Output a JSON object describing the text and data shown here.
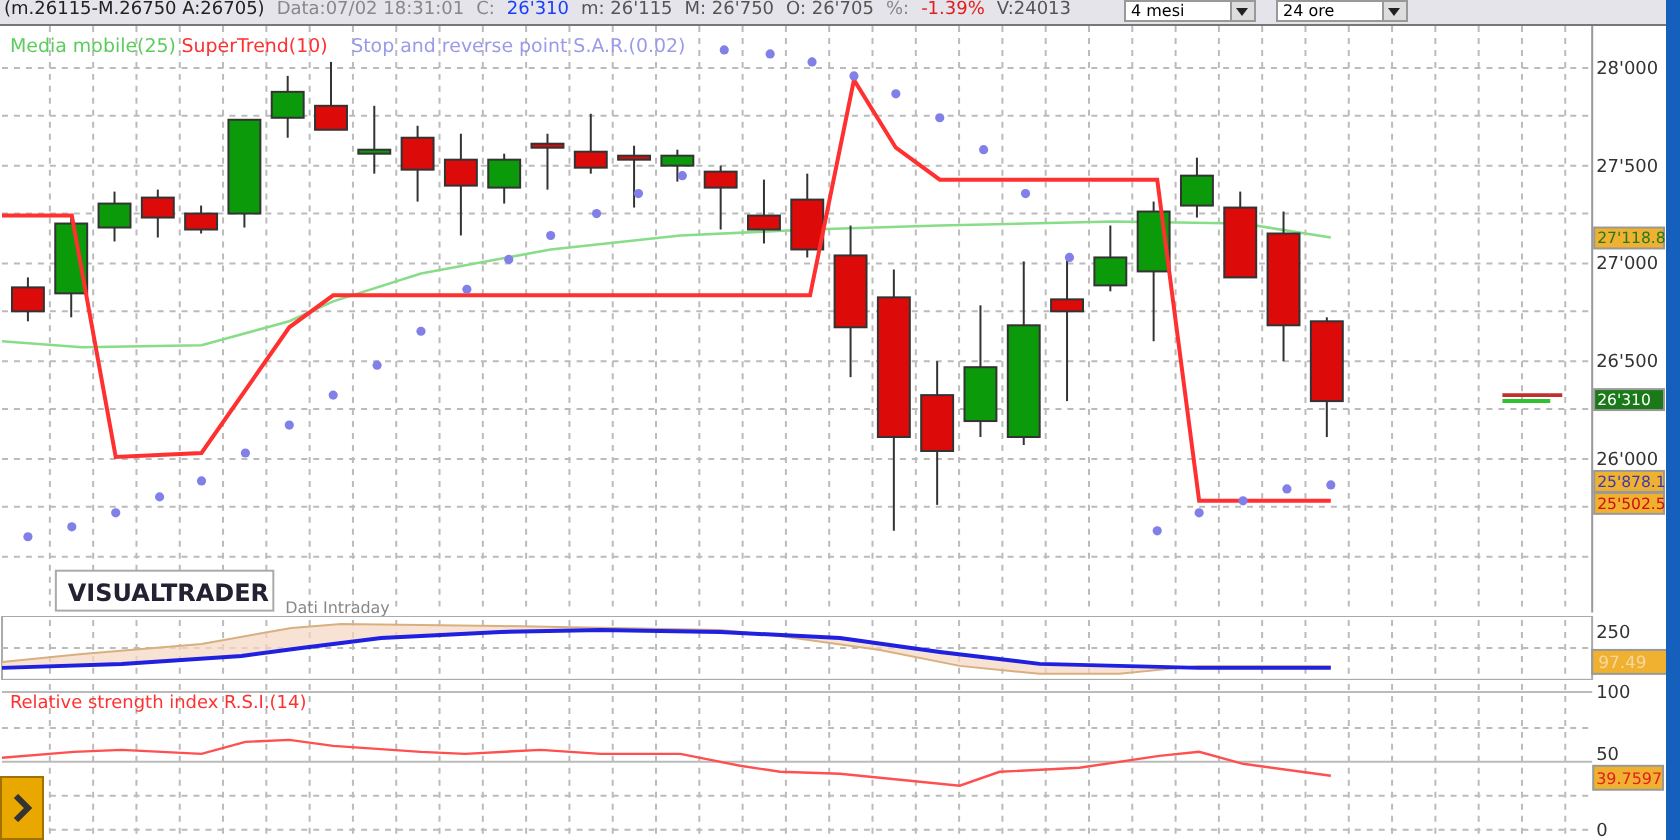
{
  "header": {
    "range": "(m.26115-M.26750 A:26705)",
    "date_label": "Data:",
    "date": "07/02 18:31:01",
    "close_label": "C:",
    "close": "26'310",
    "min_label": "m:",
    "min": "26'115",
    "max_label": "M:",
    "max": "26'750",
    "open_label": "O:",
    "open": "26'705",
    "pct_label": "%:",
    "pct": "-1.39%",
    "vol_label": "V:",
    "vol": "24013"
  },
  "dropdowns": [
    {
      "value": "4 mesi"
    },
    {
      "value": "24 ore"
    }
  ],
  "legend": [
    {
      "label": "Media mobile(25)",
      "color": "#5ccc5c"
    },
    {
      "label": "SuperTrend(10)",
      "color": "#ff3030"
    },
    {
      "label": "Stop and reverse point S.A.R.(0.02)",
      "color": "#9a9ae8"
    }
  ],
  "price_axis": [
    "28'000",
    "27'500",
    "27'000",
    "26'500",
    "26'000"
  ],
  "badges": [
    {
      "text": "27'118.8"
    },
    {
      "text": "26'310"
    },
    {
      "text": "25'878.1"
    },
    {
      "text": "25'502.5"
    }
  ],
  "logo": "VISUALTRADER",
  "source": "Dati Intraday",
  "oscillator": {
    "axis": "250",
    "badge": "97.49"
  },
  "rsi": {
    "title": "Relative strength index R.S.I.(14)",
    "axis": [
      "100",
      "50",
      "0"
    ],
    "badge": "39.7597"
  }
}
